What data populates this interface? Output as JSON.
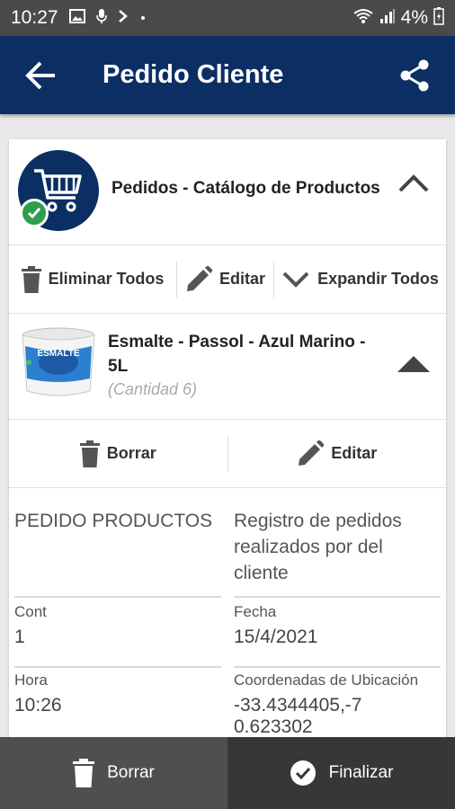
{
  "status_bar": {
    "time": "10:27",
    "battery": "4%"
  },
  "app_bar": {
    "title": "Pedido Cliente"
  },
  "catalog": {
    "title": "Pedidos - Catálogo de Productos",
    "actions": {
      "delete_all": "Eliminar Todos",
      "edit": "Editar",
      "expand_all": "Expandir Todos"
    }
  },
  "product": {
    "name": "Esmalte - Passol - Azul Marino - 5L",
    "quantity": "(Cantidad 6)",
    "image_label": "ESMALTE",
    "actions": {
      "delete": "Borrar",
      "edit": "Editar"
    }
  },
  "details": {
    "section_title": "PEDIDO PRODUCTOS",
    "description": "Registro de pedidos realizados por del cliente",
    "fields": {
      "cont": {
        "label": "Cont",
        "value": "1"
      },
      "fecha": {
        "label": "Fecha",
        "value": "15/4/2021"
      },
      "hora": {
        "label": "Hora",
        "value": "10:26"
      },
      "coords": {
        "label": "Coordenadas de Ubicación",
        "value": "-33.4344405,-70.623302"
      }
    }
  },
  "bottom_bar": {
    "delete": "Borrar",
    "finish": "Finalizar"
  }
}
